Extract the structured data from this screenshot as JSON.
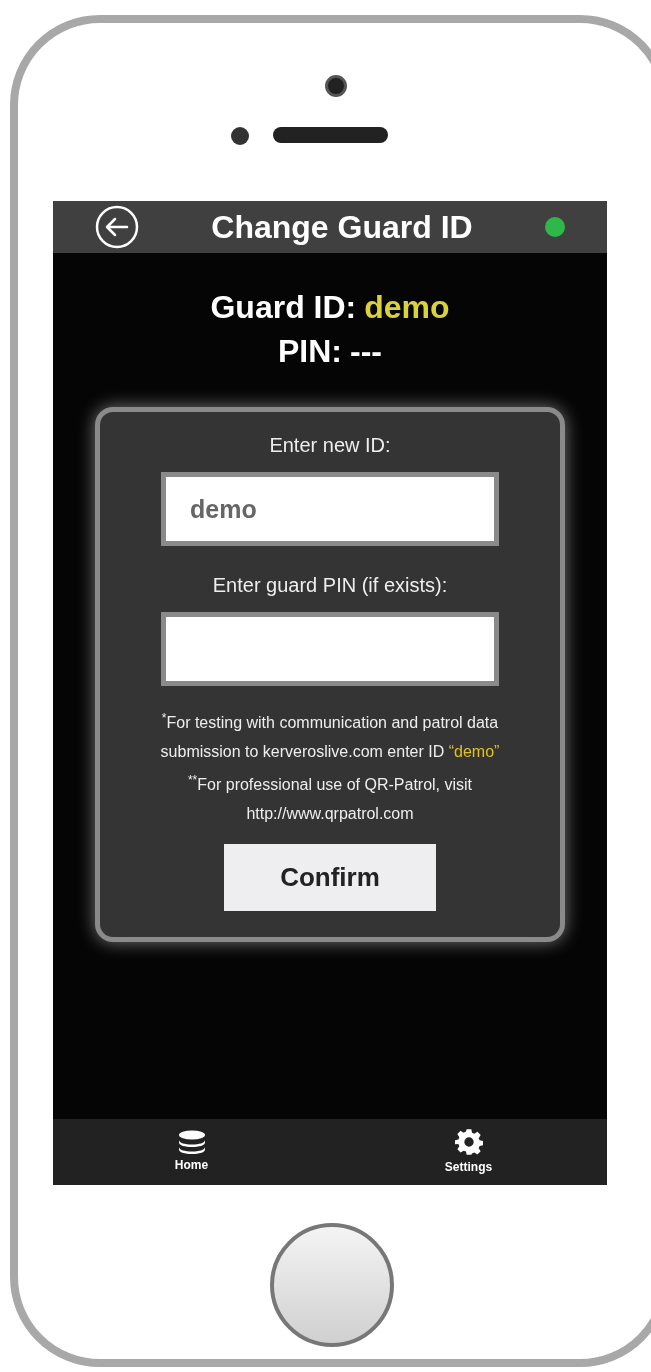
{
  "header": {
    "title": "Change Guard ID",
    "connected": true
  },
  "current": {
    "id_label": "Guard ID:",
    "id_value": "demo",
    "pin_label": "PIN:",
    "pin_value": "---"
  },
  "form": {
    "id_label": "Enter new ID:",
    "id_value": "demo",
    "pin_label": "Enter guard PIN (if exists):",
    "note_1": "$^{*}$For testing with communication and patrol data submission to kerveroslive.com enter ID ",
    "note_1_highlight": "“demo”",
    "note_2": "$^{**}$For professional use of QR-Patrol, visit http://www.qrpatrol.com",
    "confirm": "Confirm"
  },
  "tab_bar": [
    {
      "kind": "home",
      "label": "Home"
    },
    {
      "kind": "settings",
      "label": "Settings"
    }
  ]
}
